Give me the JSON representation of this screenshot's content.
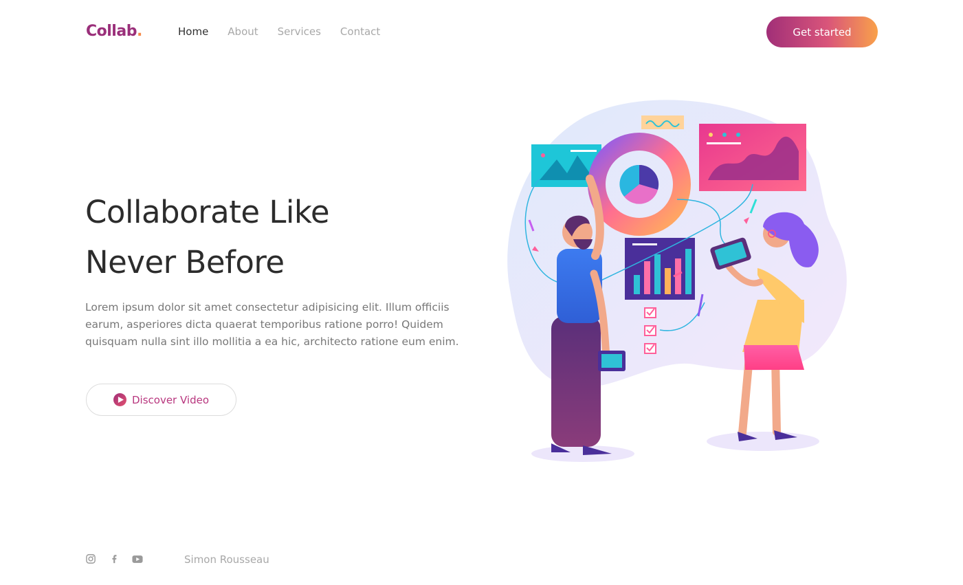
{
  "brand": {
    "name": "Collab",
    "dot": ".",
    "color": "#9a2f7a",
    "accent": "#f58a4a"
  },
  "nav": {
    "items": [
      {
        "label": "Home",
        "active": true
      },
      {
        "label": "About",
        "active": false
      },
      {
        "label": "Services",
        "active": false
      },
      {
        "label": "Contact",
        "active": false
      }
    ]
  },
  "header": {
    "cta_label": "Get started"
  },
  "hero": {
    "title_line1": "Collaborate Like",
    "title_line2": "Never Before",
    "description": "Lorem ipsum dolor sit amet consectetur adipisicing elit. Illum officiis earum, asperiores dicta quaerat temporibus ratione porro! Quidem quisquam nulla sint illo mollitia a ea hic, architecto ratione eum enim.",
    "video_button_label": "Discover Video",
    "illustration_icon": "team-collaboration-illustration"
  },
  "footer": {
    "socials": [
      "instagram-icon",
      "facebook-icon",
      "youtube-icon"
    ],
    "author": "Simon Rousseau"
  },
  "colors": {
    "gradient_start": "#a12f78",
    "gradient_end": "#f9a14a",
    "text_dark": "#2c2c2c",
    "text_muted": "#a8a8a8"
  }
}
